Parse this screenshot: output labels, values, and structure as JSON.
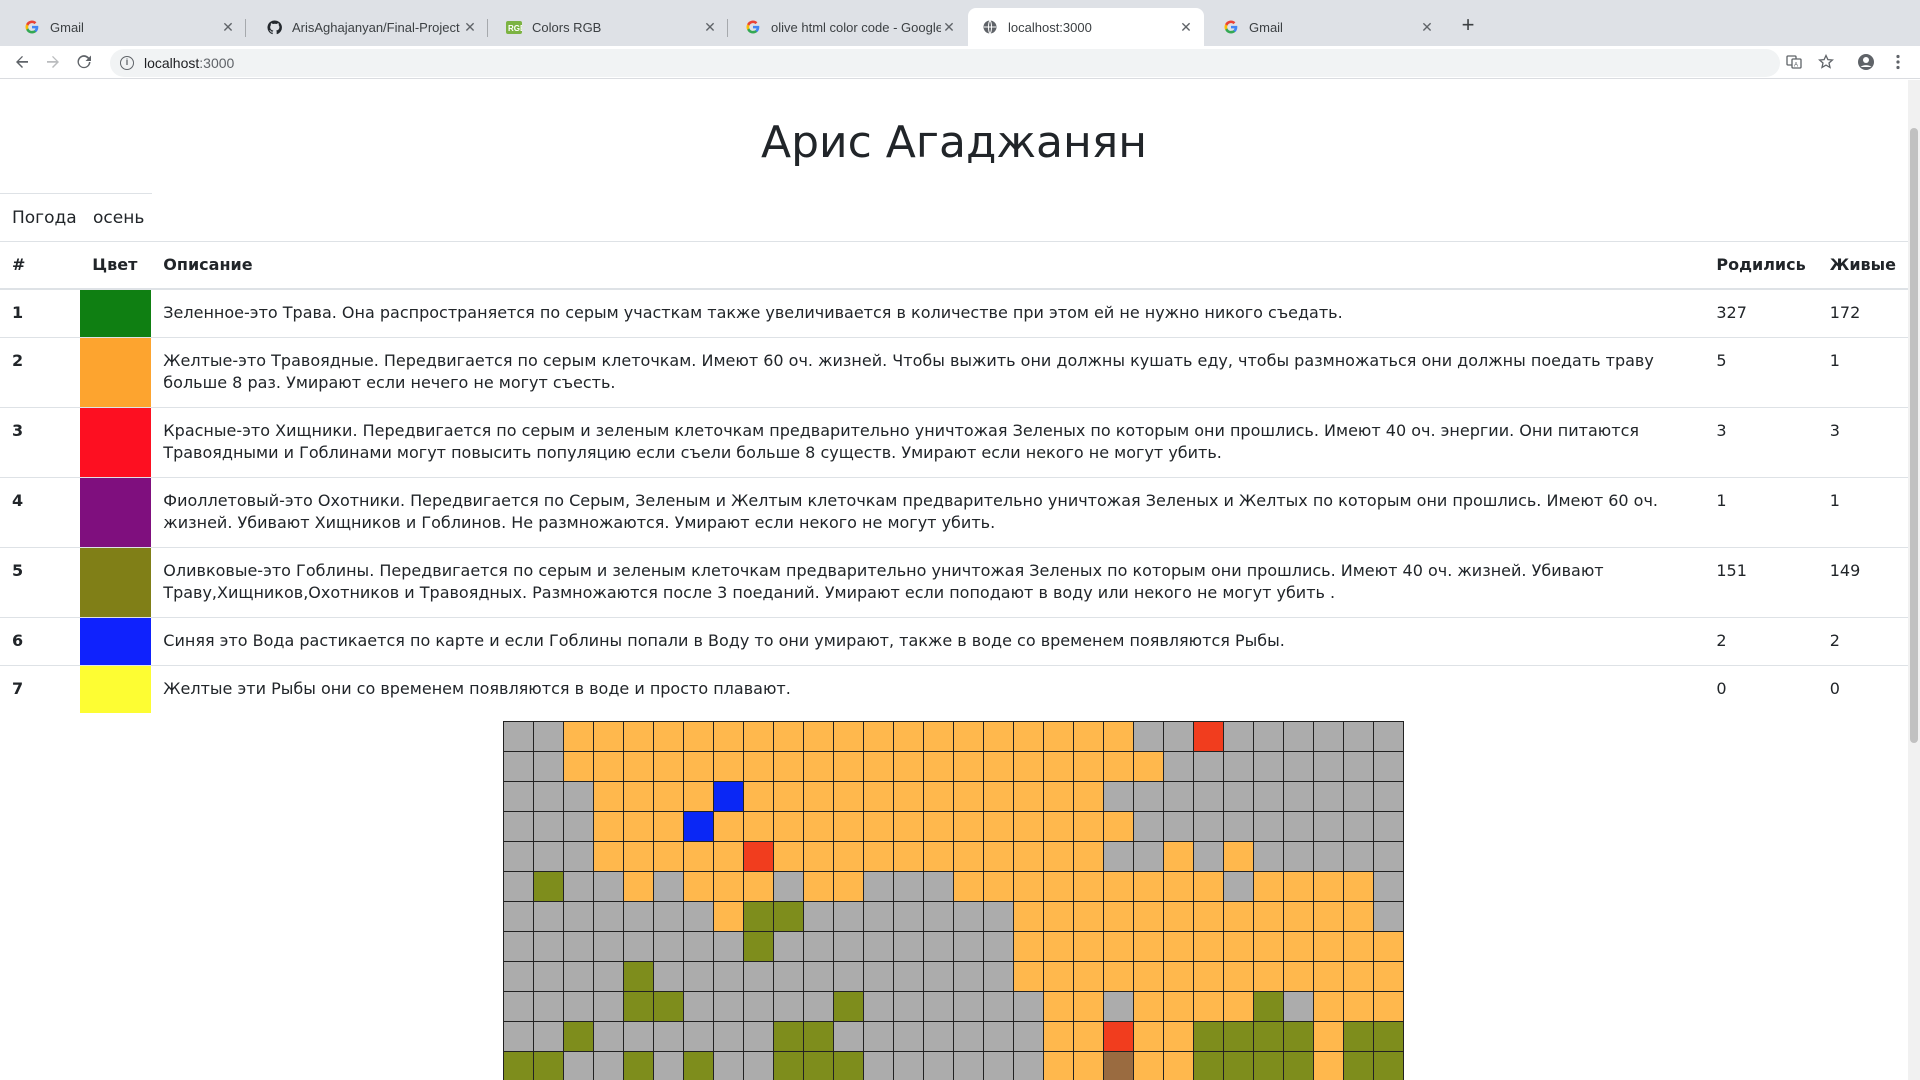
{
  "tabs": [
    {
      "title": "Gmail",
      "icon": "google-icon",
      "active": false
    },
    {
      "title": "ArisAghajanyan/Final-Project",
      "icon": "github-icon",
      "active": false
    },
    {
      "title": "Colors RGB",
      "icon": "colors-site-icon",
      "active": false
    },
    {
      "title": "olive html color code - Google",
      "icon": "google-icon",
      "active": false
    },
    {
      "title": "localhost:3000",
      "icon": "globe-icon",
      "active": true
    },
    {
      "title": "Gmail",
      "icon": "google-icon",
      "active": false
    }
  ],
  "toolbar": {
    "url_host": "localhost",
    "url_port": ":3000"
  },
  "page": {
    "title": "Арис Агаджанян",
    "weather_label": "Погода",
    "weather_value": "осень"
  },
  "table": {
    "headers": {
      "num": "#",
      "color": "Цвет",
      "desc": "Описание",
      "born": "Родились",
      "alive": "Живые"
    },
    "rows": [
      {
        "num": "1",
        "color": "#0f7f12",
        "desc": "Зеленное-это Трава. Она распространяется по серым участкам также увеличивается в количестве при этом ей не нужно никого съедать.",
        "born": "327",
        "alive": "172"
      },
      {
        "num": "2",
        "color": "#fda42f",
        "desc": "Желтые-это Травоядные. Передвигается по серым клеточкам. Имеют 60 оч. жизней. Чтобы выжить они должны кушать еду, чтобы размножаться они должны поедать траву больше 8 раз. Умирают если нечего не могут съесть.",
        "born": "5",
        "alive": "1"
      },
      {
        "num": "3",
        "color": "#fd0f21",
        "desc": "Красные-это Хищники. Передвигается по серым и зеленым клеточкам предварительно уничтожая Зеленых по которым они прошлись. Имеют 40 оч. энергии. Они питаются Травоядными и Гоблинами могут повысить популяцию если съели больше 8 существ. Умирают если некого не могут убить.",
        "born": "3",
        "alive": "3"
      },
      {
        "num": "4",
        "color": "#7f0f7e",
        "desc": "Фиоллетовый-это Охотники. Передвигается по Серым, Зеленым и Желтым клеточкам предварительно уничтожая Зеленых и Желтых по которым они прошлись. Имеют 60 оч. жизней. Убивают Хищников и Гоблинов. Не размножаются. Умирают если некого не могут убить.",
        "born": "1",
        "alive": "1"
      },
      {
        "num": "5",
        "color": "#807f17",
        "desc": "Оливковые-это Гоблины. Передвигается по серым и зеленым клеточкам предварительно уничтожая Зеленых по которым они прошлись. Имеют 40 оч. жизней. Убивают Траву,Хищников,Охотников и Травоядных. Размножаются после 3 поеданий. Умирают если поподают в воду или некого не могут убить .",
        "born": "151",
        "alive": "149"
      },
      {
        "num": "6",
        "color": "#0f22fd",
        "desc": "Синяя это Вода растикается по карте и если Гоблины попали в Воду то они умирают, также в воде со временем появляются Рыбы.",
        "born": "2",
        "alive": "2"
      },
      {
        "num": "7",
        "color": "#fdfd33",
        "desc": "Желтые эти Рыбы они со временем появляются в воде и просто плавают.",
        "born": "0",
        "alive": "0"
      }
    ]
  },
  "matrix": {
    "palette": {
      "g": "#acacac",
      "y": "#ffb84d",
      "o": "#7e8d1c",
      "b": "#0a27f5",
      "r": "#f13d1e",
      "n": "#9a6b40"
    },
    "rows": [
      "ggyyyyyyyyyyyyyyyyyyyggrgggggg",
      "ggyyyyyyyyyyyyyyyyyyyygggggggg",
      "gggyyyybyyyyyyyyyyyygggggggggg",
      "gggyyybyyyyyyyyyyyyyyggggggggg",
      "gggyyyyyryyyyyyyyyyyggygyggggg",
      "goggygyyygyygggyyyyyyyyygyyyyg",
      "gggggggyoogggggggyyyyyyyyyyyyg",
      "ggggggggoggggggggyyyyyyyyyyyyy",
      "ggggoggggggggggggyyyyyyyyyyyyy",
      "ggggoogggggoggggggyygyyyyogyyy",
      "ggoggggggoogggggggyyryyooooyoo",
      "ooggogoggoooggggggyynyyooooyoo"
    ]
  }
}
